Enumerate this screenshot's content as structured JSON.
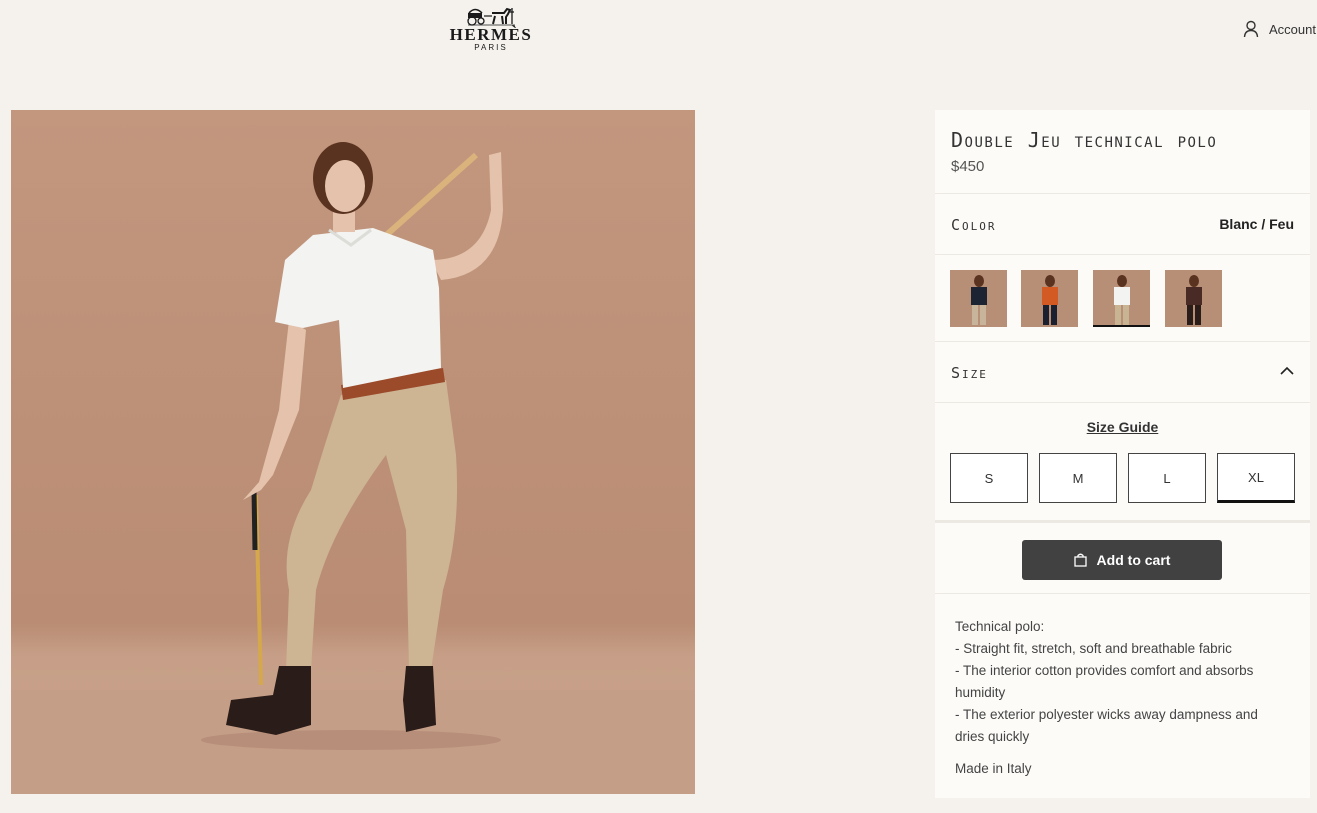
{
  "header": {
    "brand": "HERMÈS",
    "city": "PARIS",
    "account_label": "Account",
    "account_icon": "user-icon"
  },
  "product": {
    "title": "Double Jeu technical polo",
    "price": "$450",
    "color_label": "Color",
    "color_value": "Blanc / Feu",
    "swatches": [
      {
        "shirt": "#1c2433",
        "pants": "#c7b49a",
        "selected": false
      },
      {
        "shirt": "#d45a24",
        "pants": "#1b2030",
        "selected": false
      },
      {
        "shirt": "#f3f3f1",
        "pants": "#c8b493",
        "selected": true
      },
      {
        "shirt": "#4a2a24",
        "pants": "#2a1c18",
        "selected": false
      }
    ],
    "size_label": "Size",
    "size_guide": "Size Guide",
    "sizes": [
      "S",
      "M",
      "L",
      "XL"
    ],
    "selected_size": "XL",
    "add_to_cart": "Add to cart",
    "description": {
      "heading": "Technical polo:",
      "bullets": [
        "- Straight fit, stretch, soft and breathable fabric",
        "- The interior cotton provides comfort and absorbs humidity",
        "- The exterior polyester wicks away dampness and dries quickly"
      ],
      "origin": "Made in Italy"
    }
  },
  "colors": {
    "background": "#f5f2ee",
    "panel": "#fcfbf8",
    "button": "#414141",
    "image_bg": "#c2977e"
  }
}
